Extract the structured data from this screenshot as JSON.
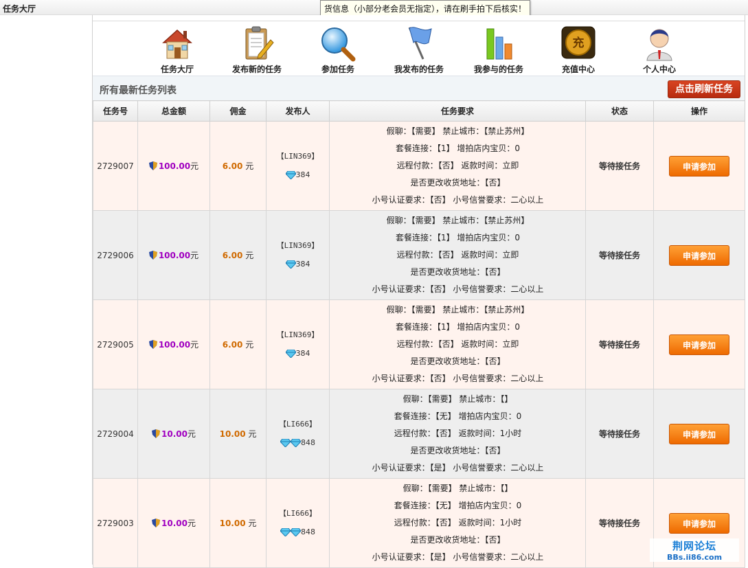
{
  "page_title": "任务大厅",
  "tooltip": "货信息（小部分老会员无指定），请在刷手拍下后核实！",
  "nav": [
    {
      "label": "任务大厅",
      "icon": "house-icon"
    },
    {
      "label": "发布新的任务",
      "icon": "clipboard-pencil-icon"
    },
    {
      "label": "参加任务",
      "icon": "magnifier-icon"
    },
    {
      "label": "我发布的任务",
      "icon": "flag-icon"
    },
    {
      "label": "我参与的任务",
      "icon": "bar-chart-icon"
    },
    {
      "label": "充值中心",
      "icon": "coin-icon"
    },
    {
      "label": "个人中心",
      "icon": "user-icon"
    }
  ],
  "list_title": "所有最新任务列表",
  "refresh_button": "点击刷新任务",
  "table": {
    "headers": [
      "任务号",
      "总金额",
      "佣金",
      "发布人",
      "任务要求",
      "状态",
      "操作"
    ],
    "rows": [
      {
        "id": "2729007",
        "amount": "100.00",
        "amount_unit": "元",
        "commission": "6.00",
        "commission_unit": "元",
        "publisher": "【LIN369】",
        "score": "384",
        "diamonds": 1,
        "req": [
          "假聊：【需要】 禁止城市：【禁止苏州】",
          "套餐连接：【1】 增拍店内宝贝：0",
          "远程付款：【否】 返款时间：立即",
          "是否更改收货地址：【否】",
          "小号认证要求：【否】 小号信誉要求：二心以上"
        ],
        "status": "等待接任务",
        "action": "申请参加"
      },
      {
        "id": "2729006",
        "amount": "100.00",
        "amount_unit": "元",
        "commission": "6.00",
        "commission_unit": "元",
        "publisher": "【LIN369】",
        "score": "384",
        "diamonds": 1,
        "req": [
          "假聊：【需要】 禁止城市：【禁止苏州】",
          "套餐连接：【1】 增拍店内宝贝：0",
          "远程付款：【否】 返款时间：立即",
          "是否更改收货地址：【否】",
          "小号认证要求：【否】 小号信誉要求：二心以上"
        ],
        "status": "等待接任务",
        "action": "申请参加"
      },
      {
        "id": "2729005",
        "amount": "100.00",
        "amount_unit": "元",
        "commission": "6.00",
        "commission_unit": "元",
        "publisher": "【LIN369】",
        "score": "384",
        "diamonds": 1,
        "req": [
          "假聊：【需要】 禁止城市：【禁止苏州】",
          "套餐连接：【1】 增拍店内宝贝：0",
          "远程付款：【否】 返款时间：立即",
          "是否更改收货地址：【否】",
          "小号认证要求：【否】 小号信誉要求：二心以上"
        ],
        "status": "等待接任务",
        "action": "申请参加"
      },
      {
        "id": "2729004",
        "amount": "10.00",
        "amount_unit": "元",
        "commission": "10.00",
        "commission_unit": "元",
        "publisher": "【LI666】",
        "score": "848",
        "diamonds": 2,
        "req": [
          "假聊：【需要】 禁止城市：【】",
          "套餐连接：【无】 增拍店内宝贝：0",
          "远程付款：【否】 返款时间：1小时",
          "是否更改收货地址：【否】",
          "小号认证要求：【是】 小号信誉要求：二心以上"
        ],
        "status": "等待接任务",
        "action": "申请参加"
      },
      {
        "id": "2729003",
        "amount": "10.00",
        "amount_unit": "元",
        "commission": "10.00",
        "commission_unit": "元",
        "publisher": "【LI666】",
        "score": "848",
        "diamonds": 2,
        "req": [
          "假聊：【需要】 禁止城市：【】",
          "套餐连接：【无】 增拍店内宝贝：0",
          "远程付款：【否】 返款时间：1小时",
          "是否更改收货地址：【否】",
          "小号认证要求：【是】 小号信誉要求：二心以上"
        ],
        "status": "等待接任务",
        "action": "申请参加"
      }
    ]
  },
  "watermark": {
    "title": "荆网论坛",
    "url": "BBs.ii86.com"
  },
  "colors": {
    "id_green": "#2c8a18",
    "amount_purple": "#a000c0",
    "commission_orange": "#d06a00",
    "status_red": "#cc1111",
    "button_orange": "#ee6a00",
    "refresh_red": "#c03515"
  }
}
